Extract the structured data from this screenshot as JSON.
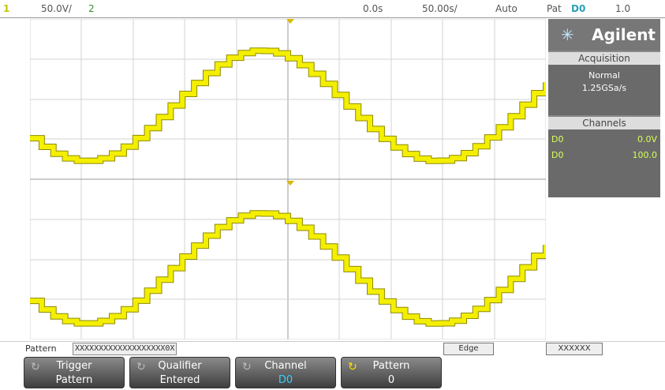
{
  "topbar": {
    "ch_num": "1",
    "volts": "50.0V/",
    "ch2": "2",
    "time_pos": "0.0s",
    "time_div": "50.00s/",
    "mode": "Auto",
    "trig_prefix": "Pat",
    "trig_channel": "D0",
    "trig_extra": "1.0"
  },
  "brand": {
    "name": "Agilent",
    "star_icon": "agilent-spark-icon"
  },
  "acquisition": {
    "title": "Acquisition",
    "mode": "Normal",
    "rate": "1.25GSa/s"
  },
  "channels": {
    "title": "Channels",
    "rows": [
      {
        "name": "D0",
        "value": "0.0V"
      },
      {
        "name": "D0",
        "value": "100.0"
      }
    ]
  },
  "pattern_bar": {
    "label": "Pattern",
    "value": "XXXXXXXXXXXXXXXXXXX0X",
    "box1": "Edge",
    "box2": "XXXXXX"
  },
  "softkeys": [
    {
      "top": "Trigger",
      "bottom": "Pattern"
    },
    {
      "top": "Qualifier",
      "bottom": "Entered"
    },
    {
      "top": "Channel",
      "bottom": "D0"
    },
    {
      "top": "Pattern",
      "bottom": "0"
    }
  ],
  "colors": {
    "trace": "#f4ef00",
    "trace_edge": "#8f8a00",
    "grid": "#d3d3d3",
    "grid_axis": "#9a9a9a",
    "accent": "#35d0ff"
  }
}
